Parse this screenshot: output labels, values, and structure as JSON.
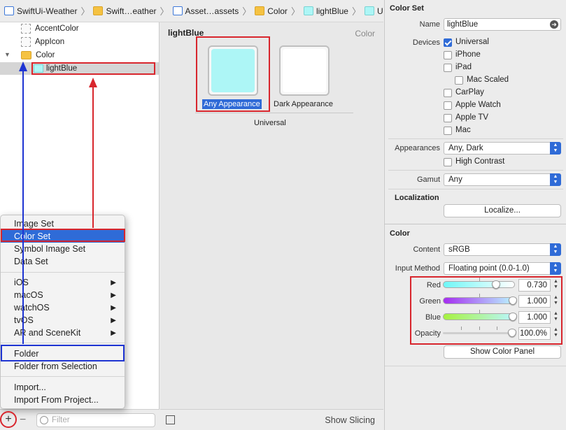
{
  "breadcrumb": [
    {
      "label": "SwiftUi-Weather",
      "icon": "swift-file-icon"
    },
    {
      "label": "Swift…eather",
      "icon": "folder-icon"
    },
    {
      "label": "Asset…assets",
      "icon": "asset-catalog-icon"
    },
    {
      "label": "Color",
      "icon": "folder-icon"
    },
    {
      "label": "lightBlue",
      "icon": "color-set-icon"
    },
    {
      "label": "Universal",
      "icon": "color-swatch-icon"
    }
  ],
  "navigator": {
    "items": [
      {
        "label": "AccentColor"
      },
      {
        "label": "AppIcon"
      },
      {
        "label": "Color"
      },
      {
        "label": "lightBlue"
      }
    ],
    "filter_placeholder": "Filter",
    "add_symbol": "+",
    "remove_symbol": "−"
  },
  "add_menu": {
    "items": [
      {
        "label": "Image Set"
      },
      {
        "label": "Color Set"
      },
      {
        "label": "Symbol Image Set"
      },
      {
        "label": "Data Set"
      },
      {
        "label": "iOS"
      },
      {
        "label": "macOS"
      },
      {
        "label": "watchOS"
      },
      {
        "label": "tvOS"
      },
      {
        "label": "AR and SceneKit"
      },
      {
        "label": "Folder"
      },
      {
        "label": "Folder from Selection"
      },
      {
        "label": "Import..."
      },
      {
        "label": "Import From Project..."
      }
    ],
    "submenu_arrow": "▶"
  },
  "editor": {
    "title": "lightBlue",
    "type_label": "Color",
    "any_label": "Any Appearance",
    "dark_label": "Dark Appearance",
    "universal_label": "Universal",
    "any_color": "#adf6f6",
    "dark_color": "#ffffff",
    "show_slicing": "Show Slicing"
  },
  "inspector": {
    "color_set": {
      "section": "Color Set",
      "name_label": "Name",
      "name_value": "lightBlue",
      "devices_label": "Devices",
      "devices": [
        {
          "label": "Universal",
          "checked": true
        },
        {
          "label": "iPhone",
          "checked": false
        },
        {
          "label": "iPad",
          "checked": false
        },
        {
          "label": "Mac Scaled",
          "checked": false
        },
        {
          "label": "CarPlay",
          "checked": false
        },
        {
          "label": "Apple Watch",
          "checked": false
        },
        {
          "label": "Apple TV",
          "checked": false
        },
        {
          "label": "Mac",
          "checked": false
        }
      ],
      "appearances_label": "Appearances",
      "appearances_value": "Any, Dark",
      "high_contrast_label": "High Contrast",
      "gamut_label": "Gamut",
      "gamut_value": "Any",
      "localization_title": "Localization",
      "localize_button": "Localize..."
    },
    "color": {
      "section": "Color",
      "content_label": "Content",
      "content_value": "sRGB",
      "input_method_label": "Input Method",
      "input_method_value": "Floating point (0.0-1.0)",
      "channels": [
        {
          "label": "Red",
          "value": "0.730",
          "fraction": 0.73,
          "from": "#6ff7f7",
          "to": "#ffffff"
        },
        {
          "label": "Green",
          "value": "1.000",
          "fraction": 1.0,
          "from": "#a52df0",
          "to": "#b9f6ff"
        },
        {
          "label": "Blue",
          "value": "1.000",
          "fraction": 1.0,
          "from": "#a6f23f",
          "to": "#b9f6ff"
        },
        {
          "label": "Opacity",
          "value": "100.0%",
          "fraction": 1.0,
          "from": "#cfcfcf",
          "to": "#cfcfcf"
        }
      ],
      "show_color_panel": "Show Color Panel"
    }
  },
  "colors": {
    "annotation_red": "#d8262d",
    "annotation_blue": "#1e34d2",
    "selection_blue": "#2f6bd7"
  }
}
